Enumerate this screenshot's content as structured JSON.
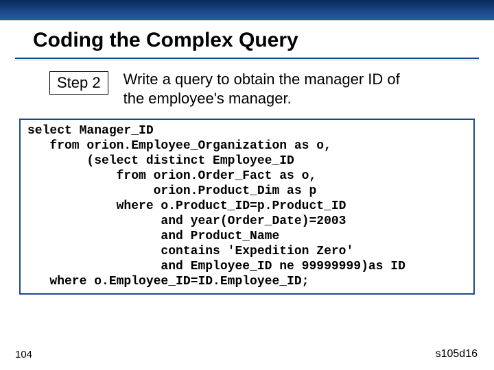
{
  "title": "Coding the Complex Query",
  "step": {
    "label": "Step 2",
    "description": "Write a query to obtain the manager ID of the employee's manager."
  },
  "code": "select Manager_ID\n   from orion.Employee_Organization as o,\n        (select distinct Employee_ID\n            from orion.Order_Fact as o,\n                 orion.Product_Dim as p\n            where o.Product_ID=p.Product_ID\n                  and year(Order_Date)=2003\n                  and Product_Name\n                  contains 'Expedition Zero'\n                  and Employee_ID ne 99999999)as ID\n   where o.Employee_ID=ID.Employee_ID;",
  "page_number": "104",
  "slide_code": "s105d16"
}
